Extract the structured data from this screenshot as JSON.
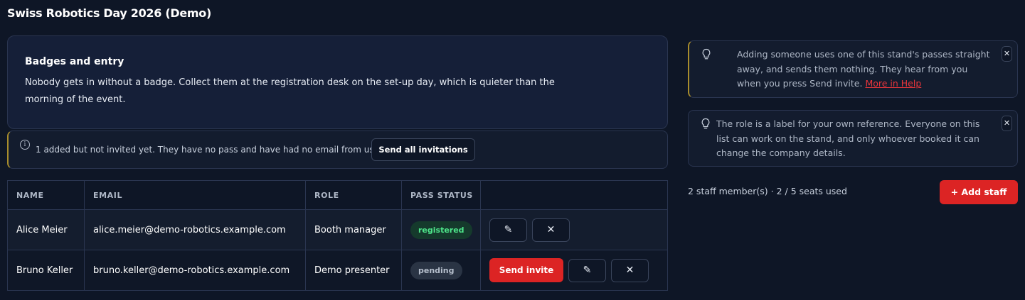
{
  "header": {
    "title": "Swiss Robotics Day 2026 (Demo)"
  },
  "info_card": {
    "title": "Badges and entry",
    "body": "Nobody gets in without a badge. Collect them at the registration desk on the set-up day, which is quieter than the morning of the event."
  },
  "notice": {
    "icon": "info-icon",
    "text": "1 added but not invited yet. They have no pass and have had no email from us.",
    "button_label": "Send all invitations"
  },
  "table": {
    "headers": [
      "NAME",
      "EMAIL",
      "ROLE",
      "PASS STATUS",
      ""
    ],
    "rows": [
      {
        "name": "Alice Meier",
        "email": "alice.meier@demo-robotics.example.com",
        "role": "Booth manager",
        "status": "registered"
      },
      {
        "name": "Bruno Keller",
        "email": "bruno.keller@demo-robotics.example.com",
        "role": "Demo presenter",
        "status": "pending",
        "invite_label": "Send invite"
      }
    ]
  },
  "tips": [
    {
      "icon": "lightbulb-icon",
      "text": "Adding someone uses one of this stand's passes straight away, and sends them nothing. They hear from you when you press Send invite.",
      "link": "More in Help",
      "close": "✕"
    },
    {
      "icon": "lightbulb-icon",
      "text": "The role is a label for your own reference. Everyone on this list can work on the stand, and only whoever booked it can change the company details.",
      "close": "✕"
    }
  ],
  "summary": "2 staff member(s) · 2 / 5 seats used",
  "add_button": "+ Add staff",
  "icons": {
    "edit": "✎",
    "remove": "✕"
  },
  "colors": {
    "accent_red": "#dc2424",
    "registered_green": "#4ee58a",
    "warning_border": "#a88d2c"
  }
}
